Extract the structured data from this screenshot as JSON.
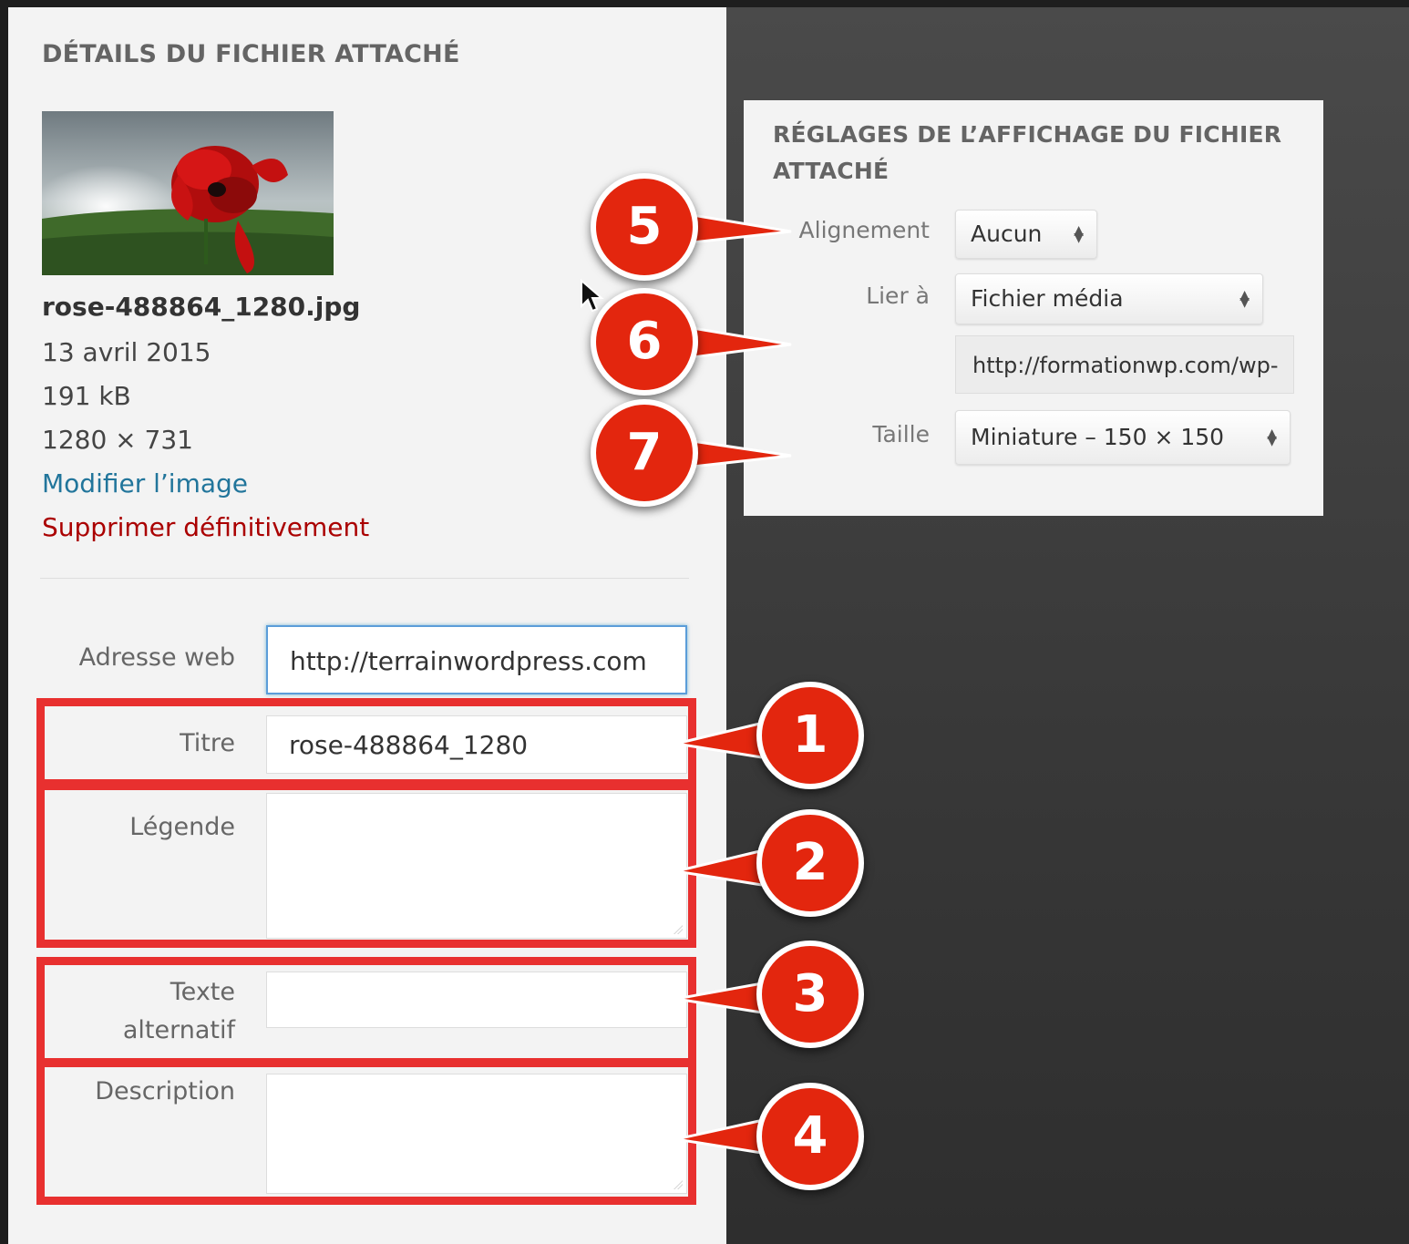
{
  "attachment": {
    "heading": "DÉTAILS DU FICHIER ATTACHÉ",
    "file_name": "rose-488864_1280.jpg",
    "date": "13 avril 2015",
    "file_size": "191 kB",
    "dimensions": "1280 × 731",
    "edit_link": "Modifier l’image",
    "delete_link": "Supprimer définitivement"
  },
  "fields": {
    "url_label": "Adresse web",
    "url_value": "http://terrainwordpress.com",
    "title_label": "Titre",
    "title_value": "rose-488864_1280",
    "caption_label": "Légende",
    "caption_value": "",
    "alt_label_line1": "Texte",
    "alt_label_line2": "alternatif",
    "alt_value": "",
    "description_label": "Description",
    "description_value": ""
  },
  "display_settings": {
    "heading": "RÉGLAGES DE L’AFFICHAGE DU FICHIER ATTACHÉ",
    "alignment_label": "Alignement",
    "alignment_value": "Aucun",
    "link_label": "Lier à",
    "link_value": "Fichier média",
    "link_url": "http://formationwp.com/wp-",
    "size_label": "Taille",
    "size_value": "Miniature – 150 × 150"
  },
  "callouts": [
    "1",
    "2",
    "3",
    "4",
    "5",
    "6",
    "7"
  ],
  "colors": {
    "callout_red": "#e3260e",
    "highlight_red": "#e8302f",
    "link_blue": "#21759b",
    "delete_red": "#aa0000"
  }
}
